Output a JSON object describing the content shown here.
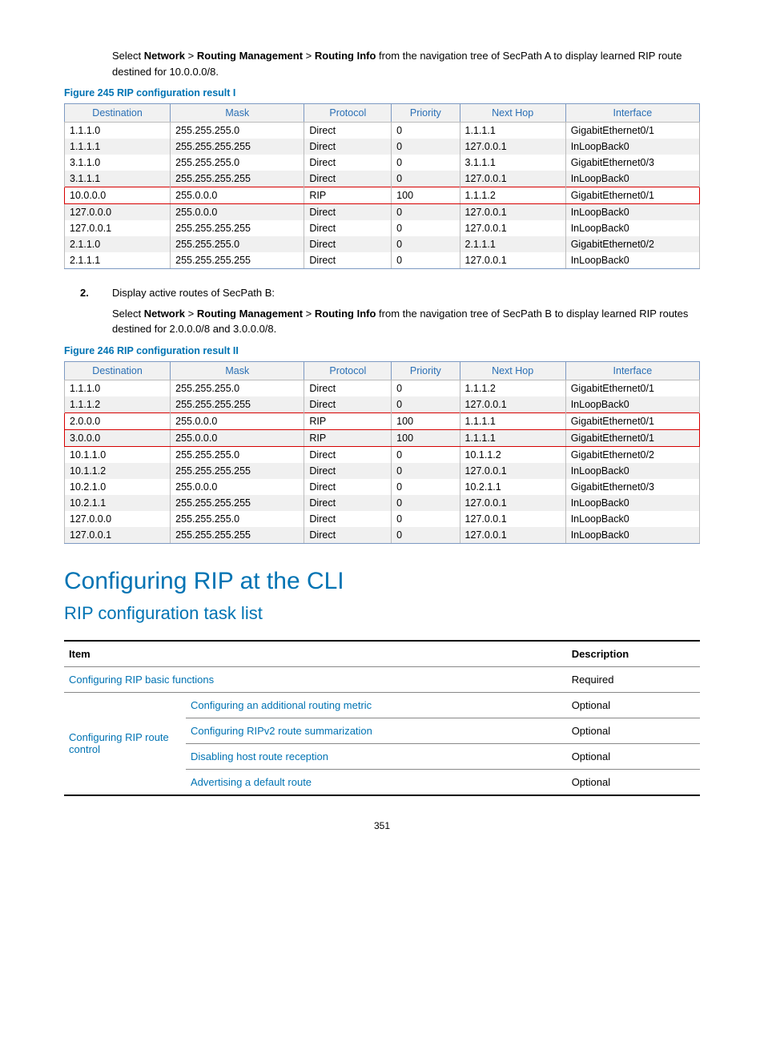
{
  "intro1": {
    "prefix": "Select ",
    "b1": "Network",
    "sep": " > ",
    "b2": "Routing Management",
    "b3": "Routing Info",
    "suffix": " from the navigation tree of SecPath A to display learned RIP route destined for 10.0.0.0/8."
  },
  "fig245_caption": "Figure 245 RIP configuration result I",
  "routing_headers": [
    "Destination",
    "Mask",
    "Protocol",
    "Priority",
    "Next Hop",
    "Interface"
  ],
  "table245": [
    {
      "dest": "1.1.1.0",
      "mask": "255.255.255.0",
      "proto": "Direct",
      "prio": "0",
      "nexthop": "1.1.1.1",
      "iface": "GigabitEthernet0/1",
      "hl": false
    },
    {
      "dest": "1.1.1.1",
      "mask": "255.255.255.255",
      "proto": "Direct",
      "prio": "0",
      "nexthop": "127.0.0.1",
      "iface": "InLoopBack0",
      "hl": false
    },
    {
      "dest": "3.1.1.0",
      "mask": "255.255.255.0",
      "proto": "Direct",
      "prio": "0",
      "nexthop": "3.1.1.1",
      "iface": "GigabitEthernet0/3",
      "hl": false
    },
    {
      "dest": "3.1.1.1",
      "mask": "255.255.255.255",
      "proto": "Direct",
      "prio": "0",
      "nexthop": "127.0.0.1",
      "iface": "InLoopBack0",
      "hl": false
    },
    {
      "dest": "10.0.0.0",
      "mask": "255.0.0.0",
      "proto": "RIP",
      "prio": "100",
      "nexthop": "1.1.1.2",
      "iface": "GigabitEthernet0/1",
      "hl": true
    },
    {
      "dest": "127.0.0.0",
      "mask": "255.0.0.0",
      "proto": "Direct",
      "prio": "0",
      "nexthop": "127.0.0.1",
      "iface": "InLoopBack0",
      "hl": false
    },
    {
      "dest": "127.0.0.1",
      "mask": "255.255.255.255",
      "proto": "Direct",
      "prio": "0",
      "nexthop": "127.0.0.1",
      "iface": "InLoopBack0",
      "hl": false
    },
    {
      "dest": "2.1.1.0",
      "mask": "255.255.255.0",
      "proto": "Direct",
      "prio": "0",
      "nexthop": "2.1.1.1",
      "iface": "GigabitEthernet0/2",
      "hl": false
    },
    {
      "dest": "2.1.1.1",
      "mask": "255.255.255.255",
      "proto": "Direct",
      "prio": "0",
      "nexthop": "127.0.0.1",
      "iface": "InLoopBack0",
      "hl": false
    }
  ],
  "step2_num": "2.",
  "step2_text": "Display active routes of SecPath B:",
  "intro2": {
    "prefix": "Select ",
    "b1": "Network",
    "sep": " > ",
    "b2": "Routing Management",
    "b3": "Routing Info",
    "suffix": " from the navigation tree of SecPath B to display learned RIP routes destined for 2.0.0.0/8 and 3.0.0.0/8."
  },
  "fig246_caption": "Figure 246 RIP configuration result II",
  "table246": [
    {
      "dest": "1.1.1.0",
      "mask": "255.255.255.0",
      "proto": "Direct",
      "prio": "0",
      "nexthop": "1.1.1.2",
      "iface": "GigabitEthernet0/1",
      "hl": false
    },
    {
      "dest": "1.1.1.2",
      "mask": "255.255.255.255",
      "proto": "Direct",
      "prio": "0",
      "nexthop": "127.0.0.1",
      "iface": "InLoopBack0",
      "hl": false
    },
    {
      "dest": "2.0.0.0",
      "mask": "255.0.0.0",
      "proto": "RIP",
      "prio": "100",
      "nexthop": "1.1.1.1",
      "iface": "GigabitEthernet0/1",
      "hl": true
    },
    {
      "dest": "3.0.0.0",
      "mask": "255.0.0.0",
      "proto": "RIP",
      "prio": "100",
      "nexthop": "1.1.1.1",
      "iface": "GigabitEthernet0/1",
      "hl": true
    },
    {
      "dest": "10.1.1.0",
      "mask": "255.255.255.0",
      "proto": "Direct",
      "prio": "0",
      "nexthop": "10.1.1.2",
      "iface": "GigabitEthernet0/2",
      "hl": false
    },
    {
      "dest": "10.1.1.2",
      "mask": "255.255.255.255",
      "proto": "Direct",
      "prio": "0",
      "nexthop": "127.0.0.1",
      "iface": "InLoopBack0",
      "hl": false
    },
    {
      "dest": "10.2.1.0",
      "mask": "255.0.0.0",
      "proto": "Direct",
      "prio": "0",
      "nexthop": "10.2.1.1",
      "iface": "GigabitEthernet0/3",
      "hl": false
    },
    {
      "dest": "10.2.1.1",
      "mask": "255.255.255.255",
      "proto": "Direct",
      "prio": "0",
      "nexthop": "127.0.0.1",
      "iface": "InLoopBack0",
      "hl": false
    },
    {
      "dest": "127.0.0.0",
      "mask": "255.255.255.0",
      "proto": "Direct",
      "prio": "0",
      "nexthop": "127.0.0.1",
      "iface": "InLoopBack0",
      "hl": false
    },
    {
      "dest": "127.0.0.1",
      "mask": "255.255.255.255",
      "proto": "Direct",
      "prio": "0",
      "nexthop": "127.0.0.1",
      "iface": "InLoopBack0",
      "hl": false
    }
  ],
  "h1": "Configuring RIP at the CLI",
  "h2": "RIP configuration task list",
  "tasklist_headers": {
    "item": "Item",
    "desc": "Description"
  },
  "tasklist": {
    "row0": {
      "item": "Configuring RIP basic functions",
      "desc": "Required"
    },
    "group_label": "Configuring RIP route control",
    "group_rows": [
      {
        "item": "Configuring an additional routing metric",
        "desc": "Optional"
      },
      {
        "item": "Configuring RIPv2 route summarization",
        "desc": "Optional"
      },
      {
        "item": "Disabling host route reception",
        "desc": "Optional"
      },
      {
        "item": "Advertising a default route",
        "desc": "Optional"
      }
    ]
  },
  "page_number": "351"
}
